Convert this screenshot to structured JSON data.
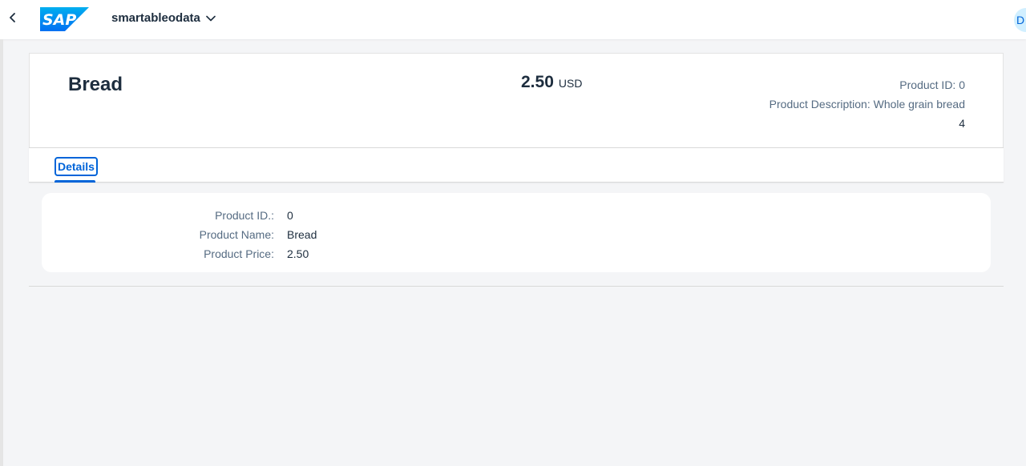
{
  "shell": {
    "app_title": "smartableodata",
    "logo_text": "SAP",
    "avatar_initial": "D",
    "brand_color": "#0070f2"
  },
  "header": {
    "title": "Bread",
    "number": "2.50",
    "unit": "USD",
    "attributes": {
      "product_id": "Product ID: 0",
      "description": "Product Description: Whole grain bread",
      "extra": "4"
    }
  },
  "tabs": [
    {
      "label": "Details",
      "selected": true
    }
  ],
  "details": {
    "fields": [
      {
        "label": "Product ID.:",
        "value": "0"
      },
      {
        "label": "Product Name:",
        "value": "Bread"
      },
      {
        "label": "Product Price:",
        "value": "2.50"
      }
    ]
  }
}
